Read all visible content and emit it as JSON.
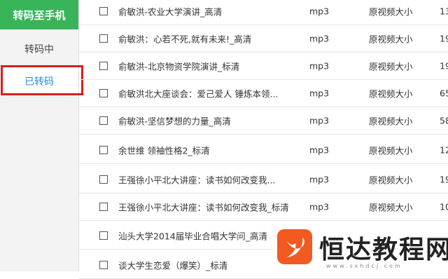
{
  "sidebar": {
    "top_label": "转码至手机",
    "items": [
      {
        "label": "转码中"
      },
      {
        "label": "已转码"
      }
    ]
  },
  "rows": [
    {
      "title": "俞敏洪-农业大学演讲_高清",
      "format": "mp3",
      "size": "原视频大小",
      "num": "13"
    },
    {
      "title": "俞敏洪：心若不死,就有未来!_高清",
      "format": "mp3",
      "size": "原视频大小",
      "num": "19"
    },
    {
      "title": "俞敏洪-北京物资学院演讲_标清",
      "format": "mp3",
      "size": "原视频大小",
      "num": "19"
    },
    {
      "title": "俞敏洪北大座谈会：爱己爱人 锤炼本领...",
      "format": "mp3",
      "size": "原视频大小",
      "num": "65"
    },
    {
      "title": "俞敏洪-坚信梦想的力量_高清",
      "format": "mp3",
      "size": "原视频大小",
      "num": "58"
    },
    {
      "title": "余世维 领袖性格2_标清",
      "format": "mp3",
      "size": "原视频大小",
      "num": "12"
    },
    {
      "title": "王强徐小平北大讲座：读书如何改变我...",
      "format": "mp3",
      "size": "原视频大小",
      "num": "19"
    },
    {
      "title": "王强徐小平北大讲座：读书如何改变我_标清",
      "format": "mp3",
      "size": "原视频大小",
      "num": "10"
    },
    {
      "title": "汕头大学2014届毕业合唱大学问_高清",
      "format": "",
      "size": "",
      "num": ""
    },
    {
      "title": "谈大学生恋爱（爆笑）_标清",
      "format": "",
      "size": "",
      "num": ""
    }
  ],
  "watermark": {
    "text": "恒达教程网",
    "url": "www.sxhdcj.com",
    "brand_color": "#f25a22"
  },
  "colors": {
    "sidebar_top": "#39b559",
    "active_item_text": "#2a8ad4",
    "highlight_border": "#d81e1e"
  }
}
